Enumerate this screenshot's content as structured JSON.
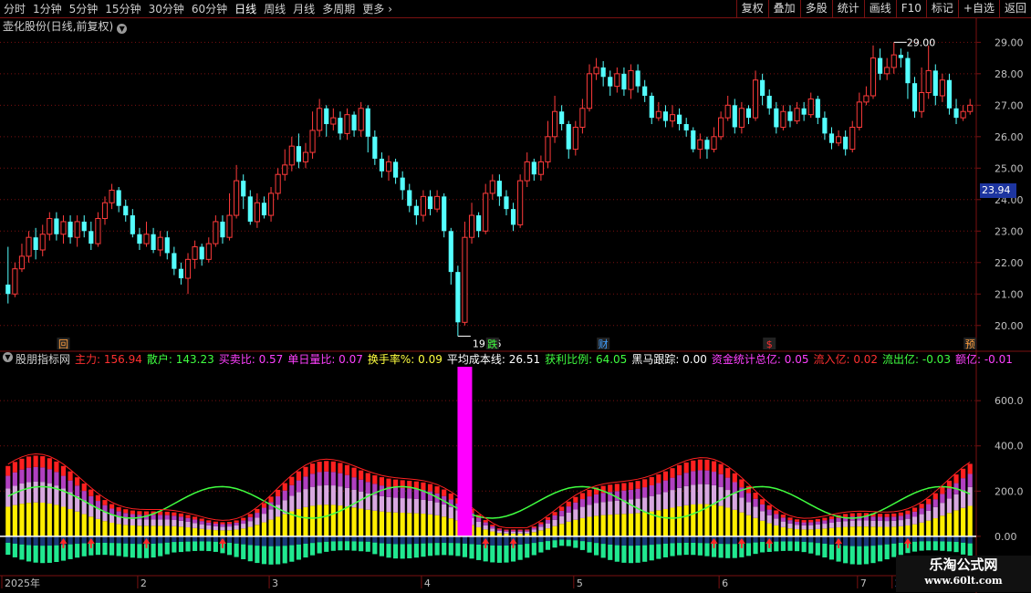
{
  "toolbar": {
    "periods": [
      "分时",
      "1分钟",
      "5分钟",
      "15分钟",
      "30分钟",
      "60分钟",
      "日线",
      "周线",
      "月线",
      "多周期",
      "更多"
    ],
    "active_period": "日线",
    "more_icon": "chevron-right-icon",
    "actions": [
      "复权",
      "叠加",
      "多股",
      "统计",
      "画线",
      "F10",
      "标记",
      "+自选",
      "返回"
    ]
  },
  "main_title": "壶化股份(日线,前复权)",
  "current_price_label": "23.94",
  "legend": {
    "name": "股朋指标网",
    "items": [
      {
        "text": "主力: 156.94",
        "color": "#ff3030"
      },
      {
        "text": "散户: 143.23",
        "color": "#40ff40"
      },
      {
        "text": "买卖比: 0.57",
        "color": "#ff40ff"
      },
      {
        "text": "单日量比: 0.07",
        "color": "#ff40ff"
      },
      {
        "text": "换手率%: 0.09",
        "color": "#ffff40"
      },
      {
        "text": "平均成本线: 26.51",
        "color": "#ffffff"
      },
      {
        "text": "获利比例: 64.05",
        "color": "#40ff40"
      },
      {
        "text": "黑马跟踪: 0.00",
        "color": "#ffffff"
      },
      {
        "text": "资金统计总亿: 0.05",
        "color": "#ff40ff"
      },
      {
        "text": "流入亿: 0.02",
        "color": "#ff3030"
      },
      {
        "text": "流出亿: -0.03",
        "color": "#40ff40"
      },
      {
        "text": "额亿: -0.01",
        "color": "#ff40ff"
      }
    ]
  },
  "price_axis": [
    "29.00",
    "28.00",
    "27.00",
    "26.00",
    "25.00",
    "24.00",
    "23.00",
    "22.00",
    "21.00",
    "20.00"
  ],
  "indicator_axis": [
    "600.0",
    "400.0",
    "200.0",
    "0.00"
  ],
  "date_axis": [
    "2025年",
    "2",
    "3",
    "4",
    "5",
    "6",
    "7",
    "2"
  ],
  "annotations": {
    "high": "29.00",
    "low": "19.66",
    "markers": [
      {
        "text": "回",
        "color": "#ffa040"
      },
      {
        "text": "跌",
        "color": "#40ff40"
      },
      {
        "text": "财",
        "color": "#40a0ff"
      },
      {
        "text": "$",
        "color": "#ff3030"
      },
      {
        "text": "预",
        "color": "#ffa040"
      }
    ]
  },
  "colors": {
    "up": "#ff3b3b",
    "down": "#54ffff",
    "grid": "#7a1111",
    "main_force": "#ff2020",
    "retail": "#40ff40",
    "fund_bar": "#ff00ff",
    "yellow": "#ffee00",
    "purple": "#b040c0",
    "lilac": "#d8a8e0"
  },
  "chart_data": {
    "type": "candlestick",
    "y_range": [
      19.5,
      29.3
    ],
    "candles": [
      [
        21.3,
        21.0,
        22.5,
        20.7
      ],
      [
        21.0,
        21.8,
        22.0,
        20.9
      ],
      [
        21.8,
        22.2,
        22.6,
        21.7
      ],
      [
        22.2,
        22.8,
        23.0,
        22.0
      ],
      [
        22.8,
        22.4,
        23.1,
        22.1
      ],
      [
        22.4,
        22.9,
        23.2,
        22.2
      ],
      [
        22.9,
        23.4,
        23.6,
        22.7
      ],
      [
        23.4,
        22.9,
        23.6,
        22.7
      ],
      [
        22.9,
        23.3,
        23.5,
        22.6
      ],
      [
        23.3,
        22.8,
        23.5,
        22.6
      ],
      [
        22.8,
        23.3,
        23.5,
        22.5
      ],
      [
        23.3,
        23.0,
        23.5,
        22.8
      ],
      [
        23.0,
        22.6,
        23.3,
        22.4
      ],
      [
        22.6,
        23.4,
        23.6,
        22.5
      ],
      [
        23.4,
        23.9,
        24.1,
        23.2
      ],
      [
        23.9,
        24.3,
        24.5,
        23.7
      ],
      [
        24.3,
        23.8,
        24.4,
        23.6
      ],
      [
        23.8,
        23.5,
        24.0,
        23.3
      ],
      [
        23.5,
        22.9,
        23.7,
        22.8
      ],
      [
        22.9,
        22.6,
        23.1,
        22.4
      ],
      [
        22.6,
        22.9,
        23.3,
        22.5
      ],
      [
        22.9,
        22.4,
        23.1,
        22.3
      ],
      [
        22.4,
        22.8,
        23.0,
        22.2
      ],
      [
        22.8,
        22.3,
        23.0,
        22.1
      ],
      [
        22.3,
        21.8,
        22.5,
        21.6
      ],
      [
        21.8,
        21.5,
        22.0,
        21.3
      ],
      [
        21.5,
        22.1,
        22.3,
        21.0
      ],
      [
        22.1,
        22.5,
        22.7,
        21.8
      ],
      [
        22.5,
        22.1,
        22.6,
        21.9
      ],
      [
        22.1,
        22.6,
        22.8,
        22.0
      ],
      [
        22.6,
        23.3,
        23.5,
        22.5
      ],
      [
        23.3,
        22.8,
        23.5,
        22.6
      ],
      [
        22.8,
        23.5,
        24.2,
        22.7
      ],
      [
        23.5,
        24.6,
        25.1,
        23.4
      ],
      [
        24.6,
        24.1,
        24.8,
        23.7
      ],
      [
        24.1,
        23.3,
        24.3,
        23.2
      ],
      [
        23.3,
        23.9,
        24.2,
        23.1
      ],
      [
        23.9,
        23.5,
        24.1,
        23.4
      ],
      [
        23.5,
        24.2,
        24.4,
        23.3
      ],
      [
        24.2,
        24.8,
        25.0,
        24.0
      ],
      [
        24.8,
        25.1,
        25.6,
        24.6
      ],
      [
        25.1,
        25.7,
        26.0,
        24.9
      ],
      [
        25.7,
        25.2,
        26.1,
        25.0
      ],
      [
        25.2,
        25.5,
        25.8,
        25.0
      ],
      [
        25.5,
        26.2,
        26.8,
        25.3
      ],
      [
        26.2,
        26.9,
        27.2,
        26.0
      ],
      [
        26.9,
        26.4,
        27.0,
        26.0
      ],
      [
        26.4,
        26.6,
        26.9,
        26.2
      ],
      [
        26.6,
        26.1,
        26.8,
        25.9
      ],
      [
        26.1,
        26.7,
        26.9,
        25.9
      ],
      [
        26.7,
        26.2,
        26.8,
        26.0
      ],
      [
        26.2,
        26.9,
        27.1,
        26.0
      ],
      [
        26.9,
        26.0,
        27.0,
        25.5
      ],
      [
        26.0,
        25.3,
        26.2,
        25.1
      ],
      [
        25.3,
        24.9,
        25.5,
        24.7
      ],
      [
        24.9,
        25.2,
        25.4,
        24.6
      ],
      [
        25.2,
        24.7,
        25.3,
        24.5
      ],
      [
        24.7,
        24.3,
        24.9,
        24.0
      ],
      [
        24.3,
        23.8,
        24.5,
        23.6
      ],
      [
        23.8,
        23.5,
        24.0,
        23.2
      ],
      [
        23.5,
        24.1,
        24.3,
        23.3
      ],
      [
        24.1,
        23.7,
        24.3,
        23.5
      ],
      [
        23.7,
        24.1,
        24.3,
        23.6
      ],
      [
        24.1,
        23.0,
        24.2,
        22.8
      ],
      [
        23.0,
        21.7,
        23.1,
        21.3
      ],
      [
        21.7,
        20.1,
        21.9,
        19.66
      ],
      [
        20.1,
        22.8,
        23.3,
        20.0
      ],
      [
        22.8,
        23.5,
        23.9,
        22.6
      ],
      [
        23.5,
        23.0,
        23.6,
        22.8
      ],
      [
        23.0,
        24.2,
        24.5,
        22.9
      ],
      [
        24.2,
        24.6,
        24.8,
        24.0
      ],
      [
        24.6,
        24.1,
        24.8,
        23.8
      ],
      [
        24.1,
        23.7,
        24.3,
        23.5
      ],
      [
        23.7,
        23.2,
        23.9,
        23.0
      ],
      [
        23.2,
        24.6,
        24.8,
        23.1
      ],
      [
        24.6,
        25.2,
        25.5,
        24.4
      ],
      [
        25.2,
        24.8,
        25.3,
        24.6
      ],
      [
        24.8,
        25.2,
        25.4,
        24.6
      ],
      [
        25.2,
        26.0,
        26.5,
        25.0
      ],
      [
        26.0,
        26.8,
        27.3,
        25.8
      ],
      [
        26.8,
        26.4,
        27.0,
        26.2
      ],
      [
        26.4,
        25.6,
        26.5,
        25.3
      ],
      [
        25.6,
        26.3,
        26.5,
        25.4
      ],
      [
        26.3,
        26.9,
        27.2,
        26.1
      ],
      [
        26.9,
        28.0,
        28.3,
        26.8
      ],
      [
        28.0,
        28.2,
        28.5,
        27.8
      ],
      [
        28.2,
        27.9,
        28.4,
        27.6
      ],
      [
        27.9,
        27.6,
        28.1,
        27.3
      ],
      [
        27.6,
        28.0,
        28.2,
        27.4
      ],
      [
        28.0,
        27.5,
        28.2,
        27.3
      ],
      [
        27.5,
        28.1,
        28.3,
        27.2
      ],
      [
        28.1,
        27.6,
        28.3,
        27.4
      ],
      [
        27.6,
        27.3,
        27.8,
        27.1
      ],
      [
        27.3,
        26.6,
        27.4,
        26.4
      ],
      [
        26.6,
        26.8,
        27.1,
        26.5
      ],
      [
        26.8,
        26.5,
        27.0,
        26.3
      ],
      [
        26.5,
        26.7,
        27.0,
        26.3
      ],
      [
        26.7,
        26.4,
        26.9,
        26.2
      ],
      [
        26.4,
        26.2,
        26.6,
        26.0
      ],
      [
        26.2,
        25.6,
        26.3,
        25.5
      ],
      [
        25.6,
        25.9,
        26.1,
        25.3
      ],
      [
        25.9,
        25.6,
        26.0,
        25.3
      ],
      [
        25.6,
        26.0,
        26.3,
        25.5
      ],
      [
        26.0,
        26.6,
        26.8,
        25.9
      ],
      [
        26.6,
        27.0,
        27.3,
        26.5
      ],
      [
        27.0,
        26.3,
        27.2,
        26.1
      ],
      [
        26.3,
        26.9,
        27.1,
        26.1
      ],
      [
        26.9,
        26.6,
        27.0,
        26.4
      ],
      [
        26.6,
        27.8,
        28.1,
        26.5
      ],
      [
        27.8,
        27.3,
        28.0,
        27.0
      ],
      [
        27.3,
        26.9,
        27.5,
        26.7
      ],
      [
        26.9,
        26.3,
        27.1,
        26.1
      ],
      [
        26.3,
        26.8,
        27.0,
        26.2
      ],
      [
        26.8,
        26.5,
        27.0,
        26.3
      ],
      [
        26.5,
        26.9,
        27.1,
        26.4
      ],
      [
        26.9,
        26.7,
        27.1,
        26.5
      ],
      [
        26.7,
        27.2,
        27.4,
        26.6
      ],
      [
        27.2,
        26.6,
        27.3,
        26.4
      ],
      [
        26.6,
        26.1,
        26.8,
        25.9
      ],
      [
        26.1,
        25.8,
        26.3,
        25.6
      ],
      [
        25.8,
        26.0,
        26.2,
        25.7
      ],
      [
        26.0,
        25.6,
        26.2,
        25.4
      ],
      [
        25.6,
        26.3,
        26.5,
        25.5
      ],
      [
        26.3,
        27.1,
        27.4,
        26.2
      ],
      [
        27.1,
        27.3,
        27.6,
        27.0
      ],
      [
        27.3,
        28.5,
        28.9,
        27.2
      ],
      [
        28.5,
        28.0,
        28.8,
        27.8
      ],
      [
        28.0,
        28.2,
        28.5,
        27.8
      ],
      [
        28.2,
        28.6,
        29.0,
        28.0
      ],
      [
        28.6,
        28.5,
        28.8,
        28.2
      ],
      [
        28.5,
        27.7,
        28.7,
        27.2
      ],
      [
        27.7,
        26.8,
        27.9,
        26.6
      ],
      [
        26.8,
        27.4,
        28.2,
        26.6
      ],
      [
        27.4,
        28.1,
        28.9,
        27.2
      ],
      [
        28.1,
        27.3,
        28.3,
        27.0
      ],
      [
        27.3,
        27.8,
        28.0,
        27.1
      ],
      [
        27.8,
        26.9,
        28.0,
        26.7
      ],
      [
        26.9,
        26.6,
        27.2,
        26.4
      ],
      [
        26.6,
        26.8,
        27.0,
        26.5
      ],
      [
        26.8,
        27.0,
        27.2,
        26.7
      ]
    ],
    "indicator": {
      "y_range": [
        -170,
        750
      ],
      "fund_spike": 750
    }
  }
}
